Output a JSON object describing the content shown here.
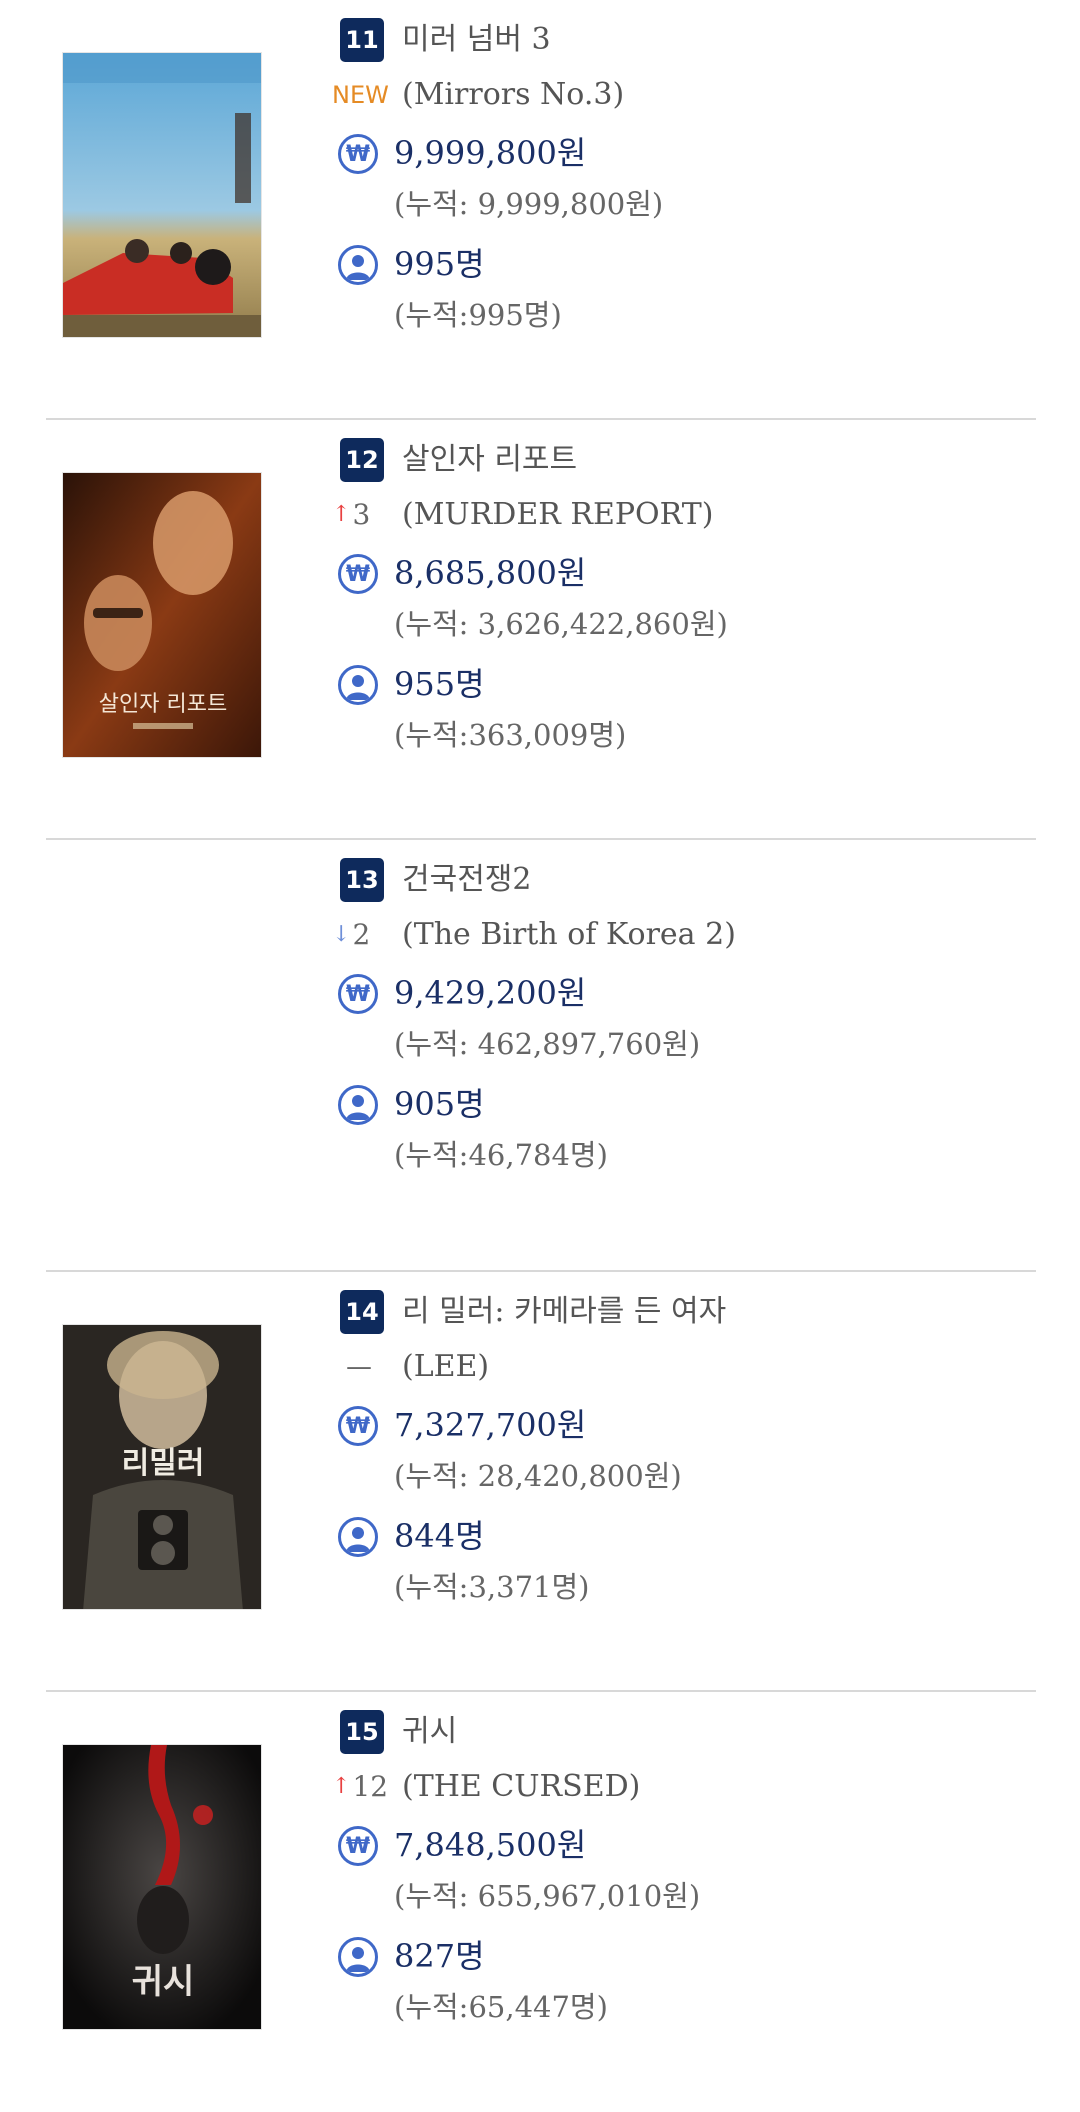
{
  "icons": {
    "sales": "won-currency-icon",
    "audience": "person-icon"
  },
  "colors": {
    "rank_badge": "#0e2a5c",
    "new_badge": "#e58b25",
    "rank_up": "#e84040",
    "rank_down": "#6e8fd8",
    "icon_accent": "#3f68c8",
    "value_text": "#1a2f66"
  },
  "movies": [
    {
      "rank": "11",
      "title_ko": "미러 넘버 3",
      "rank_change": {
        "type": "new",
        "text": "NEW"
      },
      "title_en": "(Mirrors No.3)",
      "won_symbol": "₩",
      "sales": "9,999,800원",
      "sales_total": "(누적: 9,999,800원)",
      "audience": "995명",
      "audience_total": "(누적:995명)"
    },
    {
      "rank": "12",
      "title_ko": "살인자 리포트",
      "rank_change": {
        "type": "up",
        "arrow": "↑",
        "value": "3"
      },
      "title_en": "(MURDER REPORT)",
      "won_symbol": "₩",
      "sales": "8,685,800원",
      "sales_total": "(누적: 3,626,422,860원)",
      "audience": "955명",
      "audience_total": "(누적:363,009명)",
      "poster_text": "살인자 리포트"
    },
    {
      "rank": "13",
      "title_ko": "건국전쟁2",
      "rank_change": {
        "type": "down",
        "arrow": "↓",
        "value": "2"
      },
      "title_en": "(The Birth of Korea 2)",
      "won_symbol": "₩",
      "sales": "9,429,200원",
      "sales_total": "(누적: 462,897,760원)",
      "audience": "905명",
      "audience_total": "(누적:46,784명)"
    },
    {
      "rank": "14",
      "title_ko": "리 밀러: 카메라를 든 여자",
      "rank_change": {
        "type": "same",
        "text": "—"
      },
      "title_en": "(LEE)",
      "won_symbol": "₩",
      "sales": "7,327,700원",
      "sales_total": "(누적: 28,420,800원)",
      "audience": "844명",
      "audience_total": "(누적:3,371명)",
      "poster_text": "리밀러"
    },
    {
      "rank": "15",
      "title_ko": "귀시",
      "rank_change": {
        "type": "up",
        "arrow": "↑",
        "value": "12"
      },
      "title_en": "(THE CURSED)",
      "won_symbol": "₩",
      "sales": "7,848,500원",
      "sales_total": "(누적: 655,967,010원)",
      "audience": "827명",
      "audience_total": "(누적:65,447명)",
      "poster_text": "귀시"
    }
  ]
}
